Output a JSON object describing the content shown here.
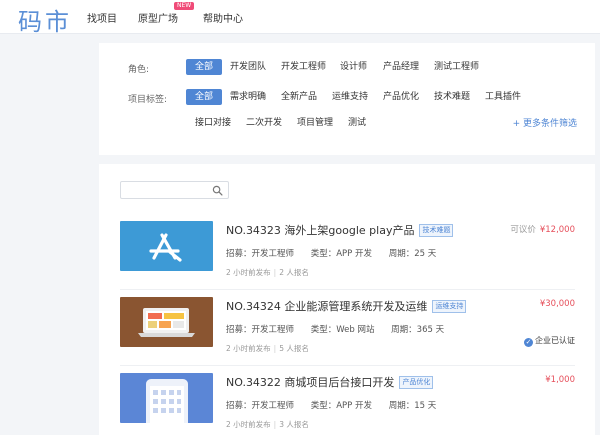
{
  "header": {
    "logo": "码市",
    "nav": [
      {
        "label": "找项目"
      },
      {
        "label": "原型广场",
        "badge": "NEW"
      },
      {
        "label": "帮助中心"
      }
    ]
  },
  "filters": {
    "role_label": "角色:",
    "roles": [
      "全部",
      "开发团队",
      "开发工程师",
      "设计师",
      "产品经理",
      "测试工程师"
    ],
    "tag_label": "项目标签:",
    "tags_row1": [
      "全部",
      "需求明确",
      "全新产品",
      "运维支持",
      "产品优化",
      "技术难题",
      "工具插件"
    ],
    "tags_row2": [
      "接口对接",
      "二次开发",
      "项目管理",
      "测试"
    ],
    "more": "+ 更多条件筛选"
  },
  "search": {
    "placeholder": ""
  },
  "projects": [
    {
      "title": "NO.34323 海外上架google play产品",
      "tag": "技术难题",
      "recruit": "招募：开发工程师",
      "type": "类型：APP 开发",
      "period": "周期：25 天",
      "posted": "2 小时前发布",
      "applicants": "2 人报名",
      "negotiable": "可议价",
      "price": "¥12,000"
    },
    {
      "title": "NO.34324 企业能源管理系统开发及运维",
      "tag": "运维支持",
      "recruit": "招募：开发工程师",
      "type": "类型：Web 网站",
      "period": "周期：365 天",
      "posted": "2 小时前发布",
      "applicants": "5 人报名",
      "negotiable": "",
      "price": "¥30,000",
      "verified": "企业已认证"
    },
    {
      "title": "NO.34322 商城项目后台接口开发",
      "tag": "产品优化",
      "recruit": "招募：开发工程师",
      "type": "类型：APP 开发",
      "period": "周期：15 天",
      "posted": "2 小时前发布",
      "applicants": "3 人报名",
      "negotiable": "",
      "price": "¥1,000"
    }
  ],
  "colors": {
    "accent": "#4f86d4",
    "price": "#e6505c",
    "badge": "#f04b78"
  }
}
